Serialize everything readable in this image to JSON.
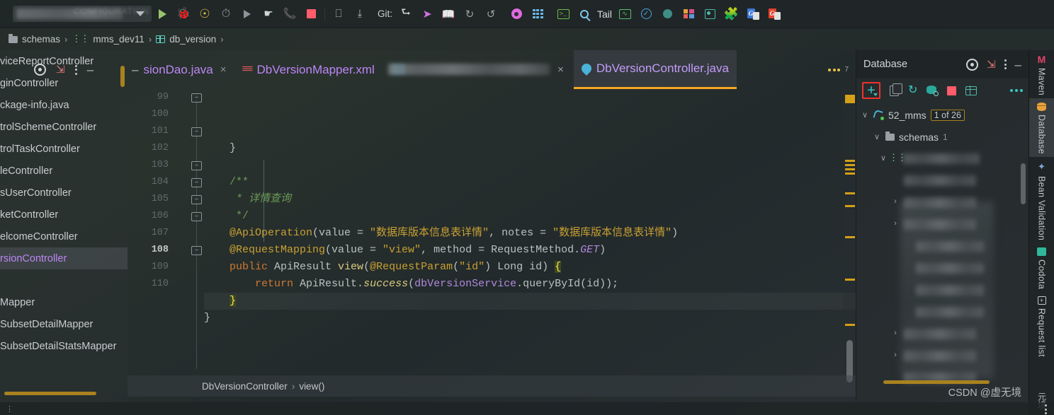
{
  "toolbar": {
    "run_config_placeholder": "CONFIGURATION",
    "git_label": "Git:",
    "tail_label": "Tail",
    "icons": [
      "run-icon",
      "debug-icon",
      "run-with-coverage-icon",
      "profile-icon",
      "run-alt-icon",
      "hand-icon",
      "call-icon",
      "stop-icon",
      "screenshot-icon",
      "download-icon",
      "branch-icon",
      "push-icon",
      "diff-icon",
      "history-icon",
      "rollback-icon",
      "settings-gear-icon",
      "grid-icon",
      "terminal-icon",
      "search-icon",
      "monitor-icon",
      "check-circle-icon",
      "teal-dot-icon",
      "layout-icon",
      "database-icon",
      "puzzle-plugin-icon",
      "google-doc-blue-icon",
      "google-doc-red-icon"
    ]
  },
  "breadcrumb": {
    "items": [
      {
        "icon": "folder-icon",
        "label": "schemas"
      },
      {
        "icon": "schema-icon",
        "label": "mms_dev11"
      },
      {
        "icon": "table-icon",
        "label": "db_version"
      }
    ],
    "separator": "›"
  },
  "project_panel": {
    "items": [
      {
        "label": "viceReportController",
        "selected": false
      },
      {
        "label": "ginController",
        "selected": false
      },
      {
        "label": "ckage-info.java",
        "selected": false
      },
      {
        "label": "trolSchemeController",
        "selected": false
      },
      {
        "label": "trolTaskController",
        "selected": false
      },
      {
        "label": "leController",
        "selected": false
      },
      {
        "label": "sUserController",
        "selected": false
      },
      {
        "label": "ketController",
        "selected": false
      },
      {
        "label": "elcomeController",
        "selected": false
      },
      {
        "label": "rsionController",
        "selected": true
      },
      {
        "label": "",
        "selected": false
      },
      {
        "label": "Mapper",
        "selected": false
      },
      {
        "label": "SubsetDetailMapper",
        "selected": false
      },
      {
        "label": "SubsetDetailStatsMapper",
        "selected": false
      }
    ]
  },
  "editor_tabs": {
    "tools": [
      "locate-target-icon",
      "collapse-all-icon",
      "more-options-icon",
      "hide-panel-icon"
    ],
    "tabs": [
      {
        "label": "sionDao.java",
        "icon": "none",
        "active": false,
        "closable": true
      },
      {
        "label": "DbVersionMapper.xml",
        "icon": "xml-icon",
        "active": false,
        "closable": false
      },
      {
        "label": "",
        "icon": "blurred",
        "active": false,
        "closable": true
      },
      {
        "label": "DbVersionController.java",
        "icon": "java-class-icon",
        "active": true,
        "closable": false
      }
    ],
    "overflow_badge": "7"
  },
  "editor": {
    "first_line": 99,
    "lines": [
      {
        "n": 99,
        "fold": "collapse",
        "current": false,
        "tokens": [
          {
            "t": "    }",
            "c": "c-punc"
          }
        ]
      },
      {
        "n": 100,
        "fold": "",
        "current": false,
        "tokens": []
      },
      {
        "n": 101,
        "fold": "collapse",
        "current": false,
        "tokens": [
          {
            "t": "    /**",
            "c": "c-cmt"
          }
        ]
      },
      {
        "n": 102,
        "fold": "",
        "current": false,
        "tokens": [
          {
            "t": "     * 详情查询",
            "c": "c-cmt c-italic"
          }
        ]
      },
      {
        "n": 103,
        "fold": "collapse",
        "current": false,
        "tokens": [
          {
            "t": "     */",
            "c": "c-cmt"
          }
        ]
      },
      {
        "n": 104,
        "fold": "collapse",
        "current": false,
        "tokens": [
          {
            "t": "    @ApiOperation",
            "c": "c-ann"
          },
          {
            "t": "(value = ",
            "c": "c-plain"
          },
          {
            "t": "\"数据库版本信息表详情\"",
            "c": "c-str"
          },
          {
            "t": ", notes = ",
            "c": "c-plain"
          },
          {
            "t": "\"数据库版本信息表详情\"",
            "c": "c-str"
          },
          {
            "t": ")",
            "c": "c-plain"
          }
        ]
      },
      {
        "n": 105,
        "fold": "collapse",
        "current": false,
        "tokens": [
          {
            "t": "    @RequestMapping",
            "c": "c-ann"
          },
          {
            "t": "(value = ",
            "c": "c-plain"
          },
          {
            "t": "\"view\"",
            "c": "c-str"
          },
          {
            "t": ", method = RequestMethod.",
            "c": "c-plain"
          },
          {
            "t": "GET",
            "c": "c-field c-italic"
          },
          {
            "t": ")",
            "c": "c-plain"
          }
        ]
      },
      {
        "n": 106,
        "fold": "collapse",
        "current": false,
        "tokens": [
          {
            "t": "    public",
            "c": "c-kw"
          },
          {
            "t": " ApiResult ",
            "c": "c-type"
          },
          {
            "t": "view",
            "c": "c-meth"
          },
          {
            "t": "(",
            "c": "c-plain"
          },
          {
            "t": "@RequestParam",
            "c": "c-ann"
          },
          {
            "t": "(",
            "c": "c-plain"
          },
          {
            "t": "\"id\"",
            "c": "c-str"
          },
          {
            "t": ") Long id) ",
            "c": "c-plain"
          },
          {
            "t": "{",
            "c": "c-brace-hl"
          }
        ]
      },
      {
        "n": 107,
        "fold": "",
        "current": false,
        "tokens": [
          {
            "t": "        return",
            "c": "c-kw"
          },
          {
            "t": " ApiResult.",
            "c": "c-type"
          },
          {
            "t": "success",
            "c": "c-meth c-italic"
          },
          {
            "t": "(",
            "c": "c-plain"
          },
          {
            "t": "dbVersionService",
            "c": "c-field"
          },
          {
            "t": ".queryById(id));",
            "c": "c-plain"
          }
        ]
      },
      {
        "n": 108,
        "fold": "collapse",
        "current": true,
        "tokens": [
          {
            "t": "    ",
            "c": "c-plain"
          },
          {
            "t": "}",
            "c": "c-brace-hl"
          }
        ]
      },
      {
        "n": 109,
        "fold": "",
        "current": false,
        "tokens": [
          {
            "t": "}",
            "c": "c-punc"
          }
        ]
      },
      {
        "n": 110,
        "fold": "",
        "current": false,
        "tokens": []
      }
    ]
  },
  "editor_status": {
    "class_name": "DbVersionController",
    "separator": "›",
    "method_name": "view()"
  },
  "database_panel": {
    "title": "Database",
    "header_icons": [
      "locate-target-icon",
      "collapse-all-icon",
      "more-options-icon",
      "hide-panel-icon"
    ],
    "toolbar_icons": [
      "add-datasource-icon",
      "duplicate-icon",
      "sync-refresh-icon",
      "jump-to-query-console-icon",
      "stop-icon",
      "table-editor-icon",
      "more-icon"
    ],
    "tree": [
      {
        "depth": 0,
        "chevron": "∨",
        "icon": "datasource-icon",
        "label": "52_mms",
        "badge": "1 of 26"
      },
      {
        "depth": 1,
        "chevron": "∨",
        "icon": "folder-icon",
        "label": "schemas",
        "count": "1"
      },
      {
        "depth": 2,
        "chevron": "∨",
        "icon": "schema-icon",
        "label": "",
        "blurred": true
      },
      {
        "depth": 3,
        "chevron": "",
        "icon": "",
        "label": "",
        "blurred": true
      },
      {
        "depth": 3,
        "chevron": "›",
        "icon": "",
        "label": "",
        "blurred": true
      },
      {
        "depth": 3,
        "chevron": "›",
        "icon": "",
        "label": "",
        "blurred": true
      },
      {
        "depth": 4,
        "chevron": "",
        "icon": "",
        "label": "",
        "blurred": true
      },
      {
        "depth": 4,
        "chevron": "",
        "icon": "",
        "label": "",
        "blurred": true
      },
      {
        "depth": 4,
        "chevron": "",
        "icon": "",
        "label": "",
        "blurred": true
      },
      {
        "depth": 4,
        "chevron": "",
        "icon": "",
        "label": "",
        "blurred": true
      },
      {
        "depth": 3,
        "chevron": "›",
        "icon": "",
        "label": "",
        "blurred": true
      },
      {
        "depth": 3,
        "chevron": "›",
        "icon": "",
        "label": "",
        "blurred": true
      },
      {
        "depth": 3,
        "chevron": "",
        "icon": "",
        "label": "",
        "blurred": true
      }
    ]
  },
  "right_strip": {
    "items": [
      {
        "label": "Maven",
        "icon": "maven-icon",
        "active": false
      },
      {
        "label": "Database",
        "icon": "database-icon",
        "active": true
      },
      {
        "label": "Bean Validation",
        "icon": "bean-validation-icon",
        "active": false
      },
      {
        "label": "Codota",
        "icon": "codota-icon",
        "active": false
      },
      {
        "label": "Request list",
        "icon": "request-list-icon",
        "active": false
      }
    ],
    "bottom_cn": "元境"
  },
  "watermark": {
    "text": "CSDN @虚无境"
  },
  "colors": {
    "accent_orange": "#f5a623",
    "tab_active_text": "#c49bfa",
    "teal": "#39c5c5",
    "red_highlight": "#f0322c",
    "marker_yellow": "#d4a017"
  }
}
